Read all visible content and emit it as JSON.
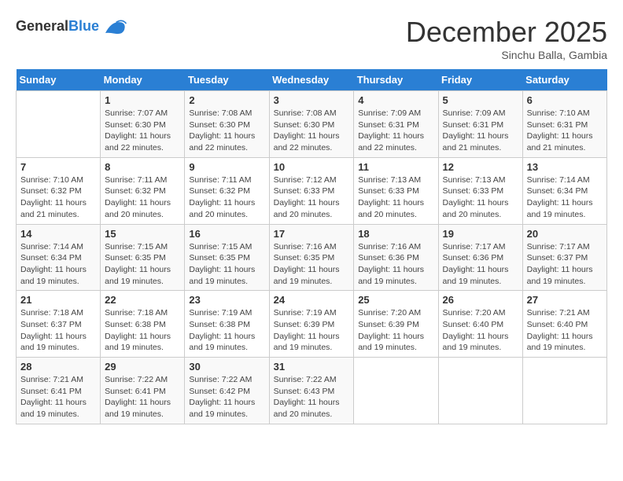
{
  "logo": {
    "general": "General",
    "blue": "Blue"
  },
  "title": "December 2025",
  "subtitle": "Sinchu Balla, Gambia",
  "header_days": [
    "Sunday",
    "Monday",
    "Tuesday",
    "Wednesday",
    "Thursday",
    "Friday",
    "Saturday"
  ],
  "weeks": [
    [
      {
        "day": "",
        "content": ""
      },
      {
        "day": "1",
        "content": "Sunrise: 7:07 AM\nSunset: 6:30 PM\nDaylight: 11 hours\nand 22 minutes."
      },
      {
        "day": "2",
        "content": "Sunrise: 7:08 AM\nSunset: 6:30 PM\nDaylight: 11 hours\nand 22 minutes."
      },
      {
        "day": "3",
        "content": "Sunrise: 7:08 AM\nSunset: 6:30 PM\nDaylight: 11 hours\nand 22 minutes."
      },
      {
        "day": "4",
        "content": "Sunrise: 7:09 AM\nSunset: 6:31 PM\nDaylight: 11 hours\nand 22 minutes."
      },
      {
        "day": "5",
        "content": "Sunrise: 7:09 AM\nSunset: 6:31 PM\nDaylight: 11 hours\nand 21 minutes."
      },
      {
        "day": "6",
        "content": "Sunrise: 7:10 AM\nSunset: 6:31 PM\nDaylight: 11 hours\nand 21 minutes."
      }
    ],
    [
      {
        "day": "7",
        "content": "Sunrise: 7:10 AM\nSunset: 6:32 PM\nDaylight: 11 hours\nand 21 minutes."
      },
      {
        "day": "8",
        "content": "Sunrise: 7:11 AM\nSunset: 6:32 PM\nDaylight: 11 hours\nand 20 minutes."
      },
      {
        "day": "9",
        "content": "Sunrise: 7:11 AM\nSunset: 6:32 PM\nDaylight: 11 hours\nand 20 minutes."
      },
      {
        "day": "10",
        "content": "Sunrise: 7:12 AM\nSunset: 6:33 PM\nDaylight: 11 hours\nand 20 minutes."
      },
      {
        "day": "11",
        "content": "Sunrise: 7:13 AM\nSunset: 6:33 PM\nDaylight: 11 hours\nand 20 minutes."
      },
      {
        "day": "12",
        "content": "Sunrise: 7:13 AM\nSunset: 6:33 PM\nDaylight: 11 hours\nand 20 minutes."
      },
      {
        "day": "13",
        "content": "Sunrise: 7:14 AM\nSunset: 6:34 PM\nDaylight: 11 hours\nand 19 minutes."
      }
    ],
    [
      {
        "day": "14",
        "content": "Sunrise: 7:14 AM\nSunset: 6:34 PM\nDaylight: 11 hours\nand 19 minutes."
      },
      {
        "day": "15",
        "content": "Sunrise: 7:15 AM\nSunset: 6:35 PM\nDaylight: 11 hours\nand 19 minutes."
      },
      {
        "day": "16",
        "content": "Sunrise: 7:15 AM\nSunset: 6:35 PM\nDaylight: 11 hours\nand 19 minutes."
      },
      {
        "day": "17",
        "content": "Sunrise: 7:16 AM\nSunset: 6:35 PM\nDaylight: 11 hours\nand 19 minutes."
      },
      {
        "day": "18",
        "content": "Sunrise: 7:16 AM\nSunset: 6:36 PM\nDaylight: 11 hours\nand 19 minutes."
      },
      {
        "day": "19",
        "content": "Sunrise: 7:17 AM\nSunset: 6:36 PM\nDaylight: 11 hours\nand 19 minutes."
      },
      {
        "day": "20",
        "content": "Sunrise: 7:17 AM\nSunset: 6:37 PM\nDaylight: 11 hours\nand 19 minutes."
      }
    ],
    [
      {
        "day": "21",
        "content": "Sunrise: 7:18 AM\nSunset: 6:37 PM\nDaylight: 11 hours\nand 19 minutes."
      },
      {
        "day": "22",
        "content": "Sunrise: 7:18 AM\nSunset: 6:38 PM\nDaylight: 11 hours\nand 19 minutes."
      },
      {
        "day": "23",
        "content": "Sunrise: 7:19 AM\nSunset: 6:38 PM\nDaylight: 11 hours\nand 19 minutes."
      },
      {
        "day": "24",
        "content": "Sunrise: 7:19 AM\nSunset: 6:39 PM\nDaylight: 11 hours\nand 19 minutes."
      },
      {
        "day": "25",
        "content": "Sunrise: 7:20 AM\nSunset: 6:39 PM\nDaylight: 11 hours\nand 19 minutes."
      },
      {
        "day": "26",
        "content": "Sunrise: 7:20 AM\nSunset: 6:40 PM\nDaylight: 11 hours\nand 19 minutes."
      },
      {
        "day": "27",
        "content": "Sunrise: 7:21 AM\nSunset: 6:40 PM\nDaylight: 11 hours\nand 19 minutes."
      }
    ],
    [
      {
        "day": "28",
        "content": "Sunrise: 7:21 AM\nSunset: 6:41 PM\nDaylight: 11 hours\nand 19 minutes."
      },
      {
        "day": "29",
        "content": "Sunrise: 7:22 AM\nSunset: 6:41 PM\nDaylight: 11 hours\nand 19 minutes."
      },
      {
        "day": "30",
        "content": "Sunrise: 7:22 AM\nSunset: 6:42 PM\nDaylight: 11 hours\nand 19 minutes."
      },
      {
        "day": "31",
        "content": "Sunrise: 7:22 AM\nSunset: 6:43 PM\nDaylight: 11 hours\nand 20 minutes."
      },
      {
        "day": "",
        "content": ""
      },
      {
        "day": "",
        "content": ""
      },
      {
        "day": "",
        "content": ""
      }
    ]
  ]
}
